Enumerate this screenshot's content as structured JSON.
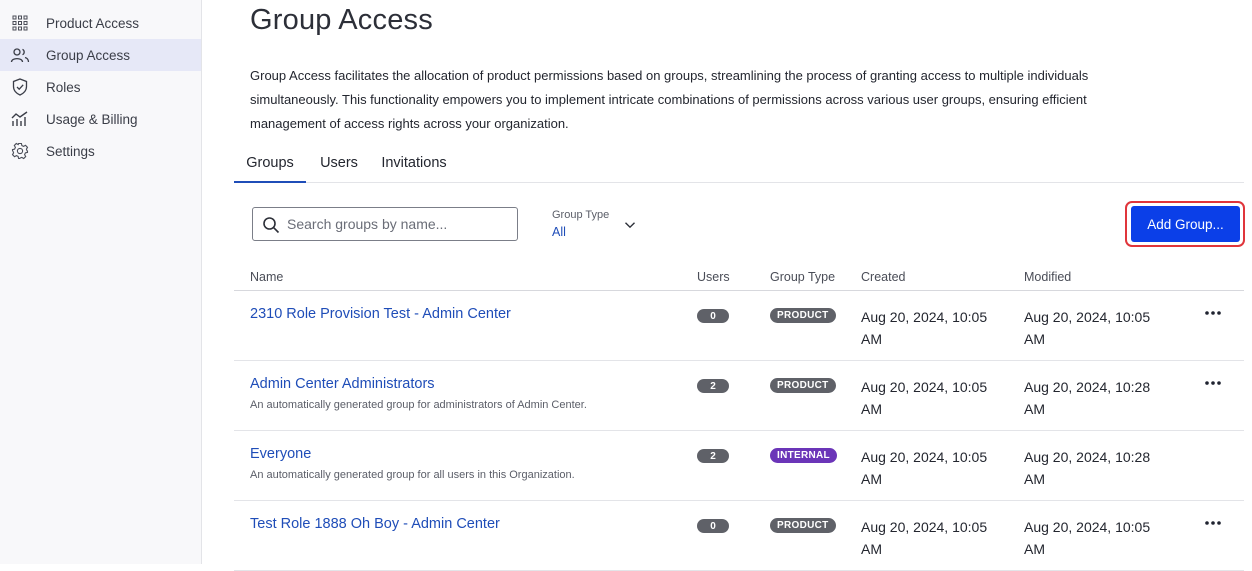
{
  "sidebar": {
    "items": [
      {
        "label": "Product Access",
        "icon": "grid-icon",
        "active": false
      },
      {
        "label": "Group Access",
        "icon": "users-icon",
        "active": true
      },
      {
        "label": "Roles",
        "icon": "shield-icon",
        "active": false
      },
      {
        "label": "Usage & Billing",
        "icon": "chart-icon",
        "active": false
      },
      {
        "label": "Settings",
        "icon": "gear-icon",
        "active": false
      }
    ]
  },
  "page": {
    "title": "Group Access",
    "description": "Group Access facilitates the allocation of product permissions based on groups, streamlining the process of granting access to multiple individuals simultaneously. This functionality empowers you to implement intricate combinations of permissions across various user groups, ensuring efficient management of access rights across your organization."
  },
  "tabs": [
    {
      "label": "Groups",
      "active": true
    },
    {
      "label": "Users",
      "active": false
    },
    {
      "label": "Invitations",
      "active": false
    }
  ],
  "search": {
    "placeholder": "Search groups by name...",
    "value": ""
  },
  "filter": {
    "label": "Group Type",
    "value": "All"
  },
  "toolbar": {
    "add_group_label": "Add Group..."
  },
  "table": {
    "headers": {
      "name": "Name",
      "users": "Users",
      "group_type": "Group Type",
      "created": "Created",
      "modified": "Modified"
    },
    "rows": [
      {
        "name": "2310 Role Provision Test - Admin Center",
        "description": "",
        "users": "0",
        "type": "PRODUCT",
        "created": "Aug 20, 2024, 10:05 AM",
        "modified": "Aug 20, 2024, 10:05 AM",
        "has_menu": true
      },
      {
        "name": "Admin Center Administrators",
        "description": "An automatically generated group for administrators of Admin Center.",
        "users": "2",
        "type": "PRODUCT",
        "created": "Aug 20, 2024, 10:05 AM",
        "modified": "Aug 20, 2024, 10:28 AM",
        "has_menu": true
      },
      {
        "name": "Everyone",
        "description": "An automatically generated group for all users in this Organization.",
        "users": "2",
        "type": "INTERNAL",
        "created": "Aug 20, 2024, 10:05 AM",
        "modified": "Aug 20, 2024, 10:28 AM",
        "has_menu": false
      },
      {
        "name": "Test Role 1888 Oh Boy - Admin Center",
        "description": "",
        "users": "0",
        "type": "PRODUCT",
        "created": "Aug 20, 2024, 10:05 AM",
        "modified": "Aug 20, 2024, 10:05 AM",
        "has_menu": true
      }
    ]
  },
  "colors": {
    "accent": "#1f4db8",
    "primary_button": "#0b3fe8",
    "highlight_outline": "#e0353b",
    "badge_product": "#5f6168",
    "badge_internal": "#6b35b8",
    "active_nav": "#e6e8f7"
  }
}
